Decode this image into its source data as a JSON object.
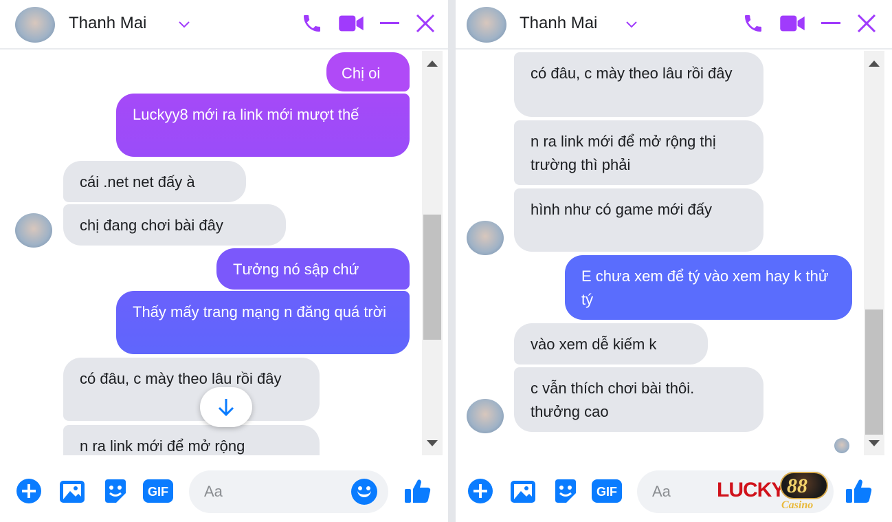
{
  "colors": {
    "accent": "#a03bfc",
    "action_blue": "#0a7cff",
    "incoming_bubble": "#e4e6eb",
    "outgoing_gradient": [
      "#b04af7",
      "#9a4cf9",
      "#7b58fb",
      "#5f66fc",
      "#5a6dfd"
    ]
  },
  "icons": {
    "header": [
      "chevron-down-icon",
      "phone-icon",
      "video-icon",
      "minimize-icon",
      "close-icon"
    ],
    "composer": [
      "plus-circle-icon",
      "image-icon",
      "sticker-icon",
      "gif-icon",
      "emoji-icon",
      "like-icon"
    ]
  },
  "left": {
    "header": {
      "name": "Thanh Mai"
    },
    "messages": [
      {
        "from": "me",
        "text": "Chị oi"
      },
      {
        "from": "me",
        "text": "Luckyy8 mới ra link mới mượt thế"
      },
      {
        "from": "them",
        "text": "cái .net net đấy à"
      },
      {
        "from": "them",
        "text": "chị đang chơi bài đây"
      },
      {
        "from": "me",
        "text": "Tưởng nó sập chứ"
      },
      {
        "from": "me",
        "text": "Thấy mấy trang mạng n đăng quá trời"
      },
      {
        "from": "them",
        "text": "có đâu, c mày theo lâu rồi đây"
      },
      {
        "from": "them",
        "text": "n ra link mới để mở rộng"
      }
    ],
    "composer": {
      "placeholder": "Aa",
      "gif_label": "GIF"
    }
  },
  "right": {
    "header": {
      "name": "Thanh Mai"
    },
    "messages": [
      {
        "from": "them",
        "text": "có đâu, c mày theo lâu rồi đây"
      },
      {
        "from": "them",
        "text": "n ra link mới để mở rộng thị trường thì phải"
      },
      {
        "from": "them",
        "text": "hình như có game mới đấy"
      },
      {
        "from": "me",
        "text": "E chưa xem để tý vào xem hay k thử tý"
      },
      {
        "from": "them",
        "text": "vào xem dễ kiếm k"
      },
      {
        "from": "them",
        "text": "c vẫn thích chơi bài thôi. thưởng cao"
      }
    ],
    "composer": {
      "placeholder": "Aa",
      "gif_label": "GIF"
    }
  },
  "watermark": {
    "brand": "LUCKY",
    "number": "88",
    "sub": "Casino"
  }
}
